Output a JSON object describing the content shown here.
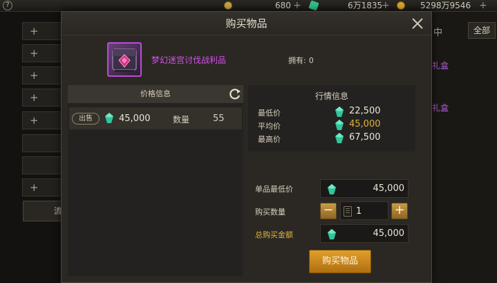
{
  "topbar": {
    "help_icon": "?",
    "currency1_value": "680",
    "currency2_value": "6万1835",
    "currency3_value": "5298万9546",
    "plus": "+"
  },
  "background": {
    "slot_plus": "+",
    "left_bottom_label": "流",
    "right_tab_fragment": "中",
    "all_button": "全部",
    "item_fragment_1": "礼盒",
    "item_fragment_2": "礼盒"
  },
  "dialog": {
    "title": "购买物品",
    "item_name": "梦幻迷宫讨伐战利品",
    "owned_label": "拥有:",
    "owned_value": "0",
    "item_border_color": "#b84fd4"
  },
  "price_info": {
    "title": "价格信息",
    "listing": {
      "tag": "出售",
      "price": "45,000",
      "qty_label": "数量",
      "qty_value": "55"
    }
  },
  "market_info": {
    "title": "行情信息",
    "rows": [
      {
        "label": "最低价",
        "value": "22,500",
        "color": "#ece6d8"
      },
      {
        "label": "平均价",
        "value": "45,000",
        "color": "#e2b43a"
      },
      {
        "label": "最高价",
        "value": "67,500",
        "color": "#ece6d8"
      }
    ]
  },
  "purchase": {
    "unit_min_label": "单品最低价",
    "unit_min_value": "45,000",
    "qty_label": "购买数量",
    "qty_value": "1",
    "minus": "−",
    "plus": "+",
    "total_label": "总购买金额",
    "total_value": "45,000",
    "buy_button": "购买物品",
    "accent_color": "#e2b43a"
  },
  "icons": {
    "gem": "green-gem-icon",
    "close": "close-icon",
    "refresh": "refresh-icon",
    "calculator": "calculator-icon"
  }
}
